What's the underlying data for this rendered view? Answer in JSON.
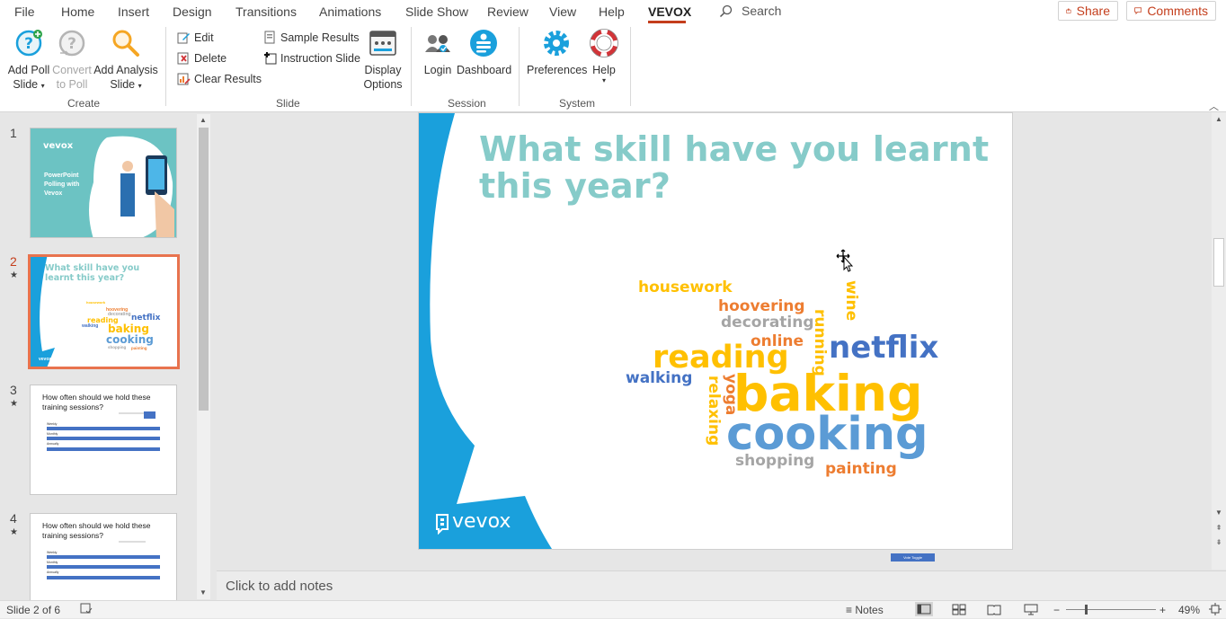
{
  "tabs": [
    "File",
    "Home",
    "Insert",
    "Design",
    "Transitions",
    "Animations",
    "Slide Show",
    "Review",
    "View",
    "Help",
    "VEVOX"
  ],
  "active_tab": "VEVOX",
  "search": {
    "label": "Search"
  },
  "share_label": "Share",
  "comments_label": "Comments",
  "ribbon": {
    "create": {
      "add_poll_line1": "Add Poll",
      "add_poll_line2": "Slide",
      "convert_line1": "Convert",
      "convert_line2": "to Poll",
      "add_analysis_line1": "Add Analysis",
      "add_analysis_line2": "Slide",
      "group_label": "Create"
    },
    "slide": {
      "edit": "Edit",
      "delete": "Delete",
      "clear_results": "Clear Results",
      "sample_results": "Sample Results",
      "instruction_slide": "Instruction Slide",
      "display_options_line1": "Display",
      "display_options_line2": "Options",
      "group_label": "Slide"
    },
    "session": {
      "login": "Login",
      "dashboard": "Dashboard",
      "group_label": "Session"
    },
    "system": {
      "preferences": "Preferences",
      "help": "Help",
      "group_label": "System"
    }
  },
  "thumbnails": [
    {
      "num": "1",
      "star": "",
      "title": "PowerPoint Polling with Vevox",
      "logo": "vevox"
    },
    {
      "num": "2",
      "star": "★",
      "title": "What skill have you learnt this year?"
    },
    {
      "num": "3",
      "star": "★",
      "title": "How often should we hold these training sessions?",
      "options": [
        "Weekly",
        "Monthly",
        "Annually"
      ]
    },
    {
      "num": "4",
      "star": "★",
      "title": "How often should we hold these training sessions?",
      "options": [
        "Weekly",
        "Monthly",
        "Annually"
      ]
    }
  ],
  "slide": {
    "title": "What skill have you learnt this year?",
    "logo_text": "vevox",
    "tag_text": "Vote Toggle",
    "colors": {
      "teal": "#86cbc9",
      "blue": "#1aa0dc",
      "yellow": "#ffc000",
      "orange": "#ed7d31",
      "gray": "#a5a5a5",
      "navy": "#4472c4",
      "sky": "#5b9bd5"
    },
    "words": [
      {
        "text": "housework",
        "color": "#ffc000"
      },
      {
        "text": "wine",
        "color": "#ffc000"
      },
      {
        "text": "hoovering",
        "color": "#ed7d31"
      },
      {
        "text": "decorating",
        "color": "#a5a5a5"
      },
      {
        "text": "running",
        "color": "#ffc000"
      },
      {
        "text": "online",
        "color": "#ed7d31"
      },
      {
        "text": "netflix",
        "color": "#4472c4"
      },
      {
        "text": "reading",
        "color": "#ffc000"
      },
      {
        "text": "walking",
        "color": "#4472c4"
      },
      {
        "text": "yoga",
        "color": "#ed7d31"
      },
      {
        "text": "relaxing",
        "color": "#ffc000"
      },
      {
        "text": "baking",
        "color": "#ffc000"
      },
      {
        "text": "cooking",
        "color": "#5b9bd5"
      },
      {
        "text": "shopping",
        "color": "#a5a5a5"
      },
      {
        "text": "painting",
        "color": "#ed7d31"
      }
    ]
  },
  "notes_placeholder": "Click to add notes",
  "status": {
    "slide_indicator": "Slide 2 of 6",
    "notes_label": "Notes",
    "zoom": "49%"
  }
}
